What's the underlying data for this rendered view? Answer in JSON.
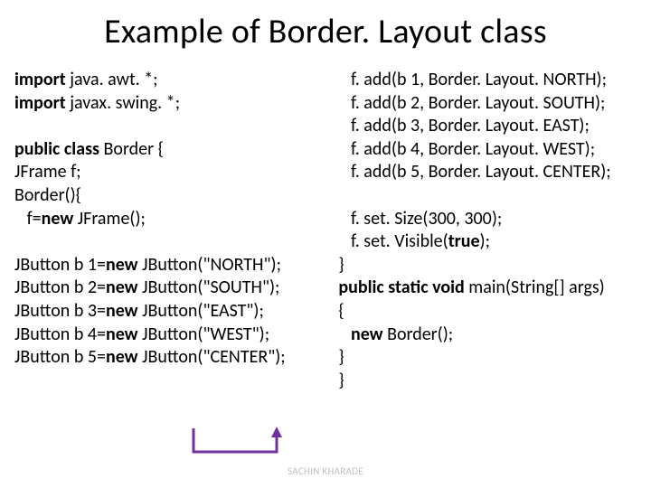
{
  "title": "Example of Border. Layout class",
  "footer": "SACHIN KHARADE",
  "code": {
    "left": [
      [
        {
          "t": "import",
          "b": true
        },
        {
          "t": " java. awt. *;",
          "b": false
        }
      ],
      [
        {
          "t": "import",
          "b": true
        },
        {
          "t": " javax. swing. *;",
          "b": false
        }
      ],
      [
        {
          "t": "",
          "b": false
        }
      ],
      [
        {
          "t": "public class ",
          "b": true
        },
        {
          "t": "Border {",
          "b": false
        }
      ],
      [
        {
          "t": "JFrame f;",
          "b": false
        }
      ],
      [
        {
          "t": "Border(){",
          "b": false
        }
      ],
      [
        {
          "t": "   f=",
          "b": false
        },
        {
          "t": "new",
          "b": true
        },
        {
          "t": " JFrame();",
          "b": false
        }
      ],
      [
        {
          "t": "",
          "b": false
        }
      ],
      [
        {
          "t": "JButton b 1=",
          "b": false
        },
        {
          "t": "new",
          "b": true
        },
        {
          "t": " JButton(\"NORTH\");",
          "b": false
        }
      ],
      [
        {
          "t": "JButton b 2=",
          "b": false
        },
        {
          "t": "new",
          "b": true
        },
        {
          "t": " JButton(\"SOUTH\");",
          "b": false
        }
      ],
      [
        {
          "t": "JButton b 3=",
          "b": false
        },
        {
          "t": "new",
          "b": true
        },
        {
          "t": " JButton(\"EAST\");",
          "b": false
        }
      ],
      [
        {
          "t": "JButton b 4=",
          "b": false
        },
        {
          "t": "new",
          "b": true
        },
        {
          "t": " JButton(\"WEST\");",
          "b": false
        }
      ],
      [
        {
          "t": "JButton b 5=",
          "b": false
        },
        {
          "t": "new",
          "b": true
        },
        {
          "t": " JButton(\"CENTER\");",
          "b": false
        }
      ]
    ],
    "right": [
      [
        {
          "t": "   f. add(b 1, Border. Layout. NORTH);",
          "b": false
        }
      ],
      [
        {
          "t": "   f. add(b 2, Border. Layout. SOUTH);",
          "b": false
        }
      ],
      [
        {
          "t": "   f. add(b 3, Border. Layout. EAST);",
          "b": false
        }
      ],
      [
        {
          "t": "   f. add(b 4, Border. Layout. WEST);",
          "b": false
        }
      ],
      [
        {
          "t": "   f. add(b 5, Border. Layout. CENTER);",
          "b": false
        }
      ],
      [
        {
          "t": "",
          "b": false
        }
      ],
      [
        {
          "t": "   f. set. Size(300, 300);",
          "b": false
        }
      ],
      [
        {
          "t": "   f. set. Visible(",
          "b": false
        },
        {
          "t": "true",
          "b": true
        },
        {
          "t": ");",
          "b": false
        }
      ],
      [
        {
          "t": "}",
          "b": false
        }
      ],
      [
        {
          "t": "public static void ",
          "b": true
        },
        {
          "t": "main(String[] args)",
          "b": false
        }
      ],
      [
        {
          "t": "{",
          "b": false
        }
      ],
      [
        {
          "t": "   ",
          "b": false
        },
        {
          "t": "new",
          "b": true
        },
        {
          "t": " Border();",
          "b": false
        }
      ],
      [
        {
          "t": "}",
          "b": false
        }
      ],
      [
        {
          "t": "}",
          "b": false
        }
      ]
    ]
  },
  "arrow_color": "#7030a0"
}
